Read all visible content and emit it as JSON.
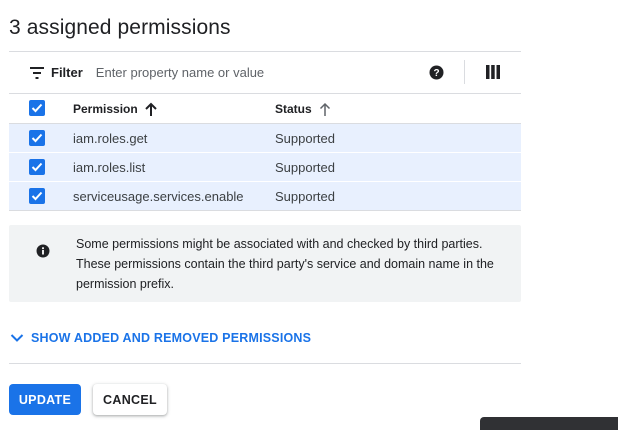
{
  "header": {
    "title": "3 assigned permissions"
  },
  "filter": {
    "label": "Filter",
    "placeholder": "Enter property name or value",
    "icon": "filter-list-icon",
    "help_icon": "help-icon",
    "columns_icon": "view-columns-icon"
  },
  "table": {
    "columns": {
      "permission": "Permission",
      "status": "Status"
    },
    "rows": [
      {
        "permission": "iam.roles.get",
        "status": "Supported",
        "checked": true
      },
      {
        "permission": "iam.roles.list",
        "status": "Supported",
        "checked": true
      },
      {
        "permission": "serviceusage.services.enable",
        "status": "Supported",
        "checked": true
      }
    ]
  },
  "info": {
    "icon": "info-icon",
    "text": "Some permissions might be associated with and checked by third parties. These permissions contain the third party's service and domain name in the permission prefix."
  },
  "expander": {
    "label": "SHOW ADDED AND REMOVED PERMISSIONS",
    "icon": "chevron-down-icon"
  },
  "actions": {
    "update_label": "UPDATE",
    "cancel_label": "CANCEL"
  },
  "colors": {
    "accent": "#1a73e8",
    "selected_row": "#e8f0fe",
    "info_bg": "#f1f3f4"
  }
}
